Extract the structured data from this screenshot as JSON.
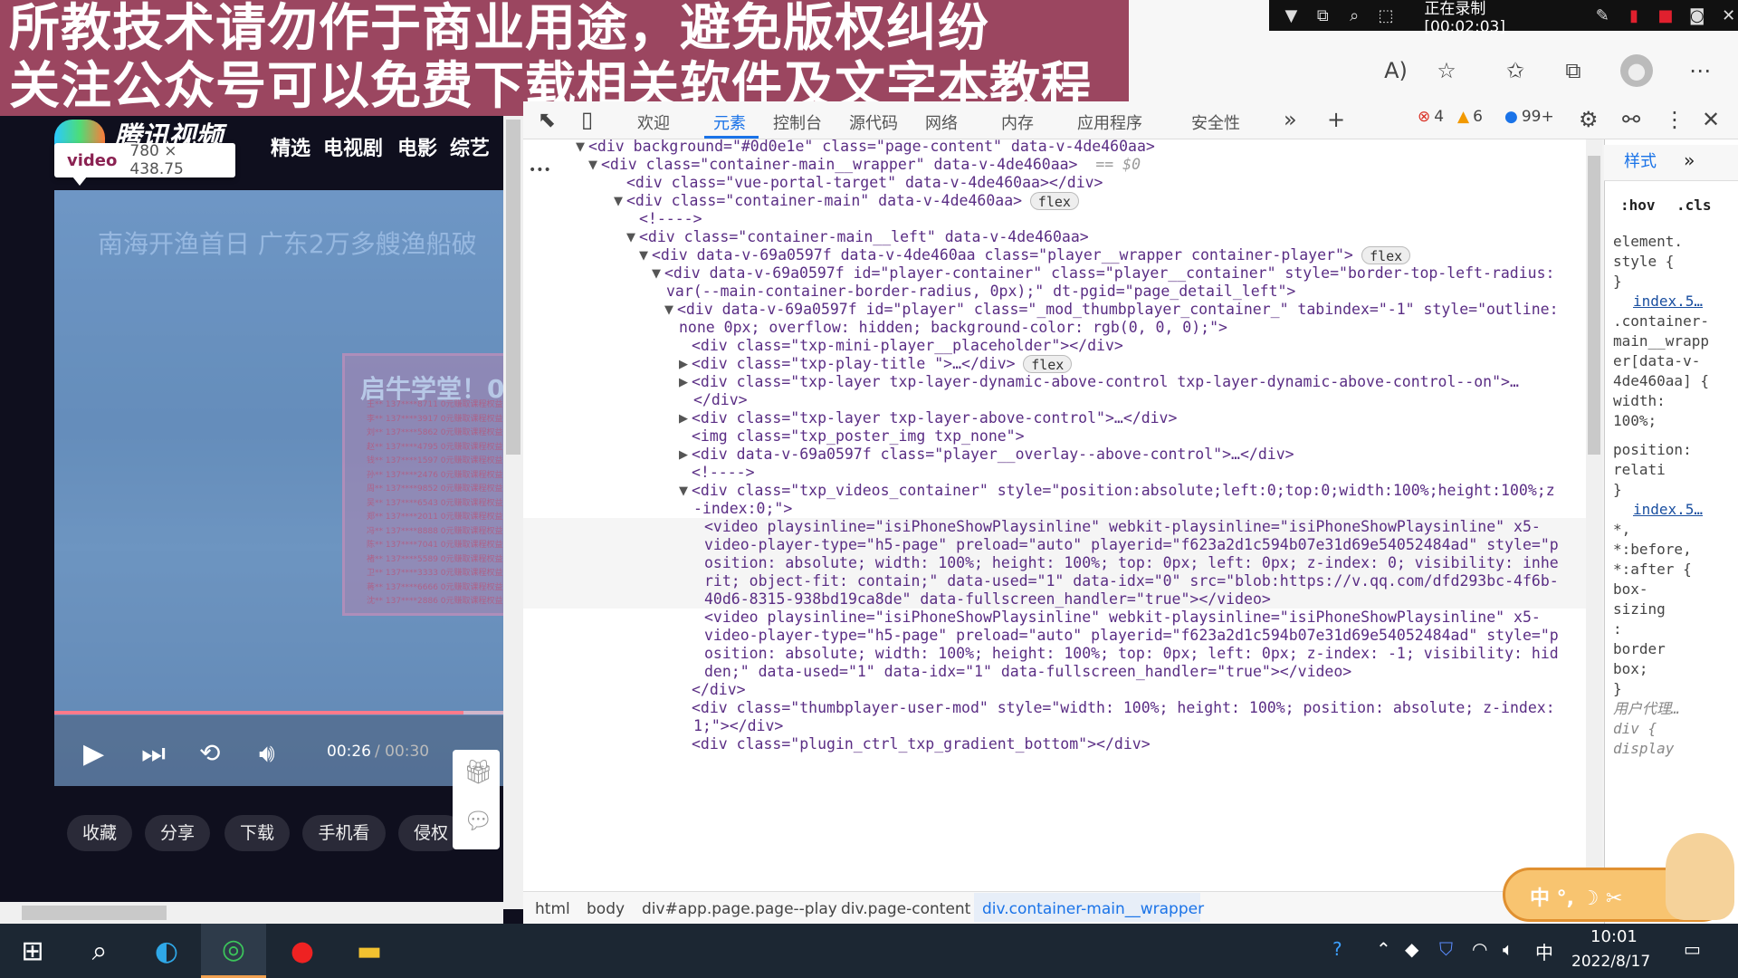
{
  "banner": {
    "line1": "所教技术请勿作于商业用途，避免版权纠纷",
    "line2": "关注公众号可以免费下载相关软件及文字本教程"
  },
  "recorder": {
    "status": "正在录制 [00:02:03]"
  },
  "site": {
    "logo": "腾讯视频",
    "nav": [
      "精选",
      "电视剧",
      "电影",
      "综艺"
    ]
  },
  "tooltip": {
    "tag": "video",
    "dimensions": "780 × 438.75"
  },
  "player": {
    "title": "南海开渔首日 广东2万多艘渔船破",
    "ad_title": "启牛学堂！0",
    "ad_rows": [
      "王**  137****8711  0元赚取课程权益",
      "李**  137****3917  0元赚取课程权益",
      "刘**  137****5862  0元赚取课程权益",
      "赵**  137****4795  0元赚取课程权益",
      "钱**  137****1597  0元赚取课程权益",
      "孙**  137****2476  0元赚取课程权益",
      "周**  137****9852  0元赚取课程权益",
      "吴**  137****6543  0元赚取课程权益",
      "郑**  137****2011  0元赚取课程权益",
      "冯**  137****8888  0元赚取课程权益",
      "陈**  137****7041  0元赚取课程权益",
      "褚**  137****5589  0元赚取课程权益",
      "卫**  137****3333  0元赚取课程权益",
      "蒋**  137****6666  0元赚取课程权益",
      "沈**  137****2886  0元赚取课程权益"
    ],
    "time_current": "00:26",
    "time_total": "/ 00:30",
    "progress": 0.87,
    "actions": [
      "收藏",
      "分享",
      "下载",
      "手机看",
      "侵权"
    ]
  },
  "devtools": {
    "tabs": [
      "欢迎",
      "元素",
      "控制台",
      "源代码",
      "网络",
      "内存",
      "应用程序",
      "安全性"
    ],
    "active_tab": "元素",
    "errors": "4",
    "warnings": "6",
    "issues": "99+",
    "dom": [
      {
        "text": "<div background=\"#0d0e1e\" class=\"page-content\" data-v-4de460aa>",
        "arrow": "▼"
      },
      {
        "text": "<div class=\"container-main__wrapper\" data-v-4de460aa>",
        "arrow": "▼",
        "suffix": "== $0"
      },
      {
        "text": "<div class=\"vue-portal-target\" data-v-4de460aa></div>"
      },
      {
        "text": "<div class=\"container-main\" data-v-4de460aa>",
        "arrow": "▼",
        "chip": "flex"
      },
      {
        "text": "<!---->"
      },
      {
        "text": "<div class=\"container-main__left\" data-v-4de460aa>",
        "arrow": "▼"
      },
      {
        "text": "<div data-v-69a0597f data-v-4de460aa class=\"player__wrapper container-player\">",
        "arrow": "▼",
        "chip": "flex"
      },
      {
        "text": "<div data-v-69a0597f id=\"player-container\" class=\"player__container\" style=\"border-top-left-radius:",
        "arrow": "▼"
      },
      {
        "text": "var(--main-container-border-radius, 0px);\" dt-pgid=\"page_detail_left\">"
      },
      {
        "text": "<div data-v-69a0597f id=\"player\" class=\"_mod_thumbplayer_container_\" tabindex=\"-1\" style=\"outline:",
        "arrow": "▼"
      },
      {
        "text": "none 0px; overflow: hidden; background-color: rgb(0, 0, 0);\">"
      },
      {
        "text": "<div class=\"txp-mini-player__placeholder\"></div>"
      },
      {
        "text": "<div class=\"txp-play-title \">…</div>",
        "arrow": "▶",
        "chip": "flex"
      },
      {
        "text": "<div class=\"txp-layer txp-layer-dynamic-above-control txp-layer-dynamic-above-control--on\">…",
        "arrow": "▶"
      },
      {
        "text": "</div>"
      },
      {
        "text": "<div class=\"txp-layer txp-layer-above-control\">…</div>",
        "arrow": "▶"
      },
      {
        "text": "<img class=\"txp_poster_img txp_none\">"
      },
      {
        "text": "<div data-v-69a0597f class=\"player__overlay--above-control\">…</div>",
        "arrow": "▶"
      },
      {
        "text": "<!---->"
      },
      {
        "text": "<div class=\"txp_videos_container\" style=\"position:absolute;left:0;top:0;width:100%;height:100%;z",
        "arrow": "▼"
      },
      {
        "text": "-index:0;\">"
      },
      {
        "text": "<video playsinline=\"isiPhoneShowPlaysinline\" webkit-playsinline=\"isiPhoneShowPlaysinline\" x5-"
      },
      {
        "text": "video-player-type=\"h5-page\" preload=\"auto\" playerid=\"f623a2d1c594b07e31d69e54052484ad\" style=\"p"
      },
      {
        "text": "osition: absolute; width: 100%; height: 100%; top: 0px; left: 0px; z-index: 0; visibility: inhe"
      },
      {
        "text": "rit; object-fit: contain;\" data-used=\"1\" data-idx=\"0\" src=\"blob:https://v.qq.com/dfd293bc-4f6b-"
      },
      {
        "text": "40d6-8315-938bd19ca8de\" data-fullscreen_handler=\"true\"></video>"
      },
      {
        "text": "<video playsinline=\"isiPhoneShowPlaysinline\" webkit-playsinline=\"isiPhoneShowPlaysinline\" x5-"
      },
      {
        "text": "video-player-type=\"h5-page\" preload=\"auto\" playerid=\"f623a2d1c594b07e31d69e54052484ad\" style=\"p"
      },
      {
        "text": "osition: absolute; width: 100%; height: 100%; top: 0px; left: 0px; z-index: -1; visibility: hid"
      },
      {
        "text": "den;\" data-used=\"1\" data-idx=\"1\" data-fullscreen_handler=\"true\"></video>"
      },
      {
        "text": "</div>"
      },
      {
        "text": "<div class=\"thumbplayer-user-mod\" style=\"width: 100%; height: 100%; position: absolute; z-index:"
      },
      {
        "text": "1;\"></div>"
      },
      {
        "text": "<div class=\"plugin_ctrl_txp_gradient_bottom\"></div>"
      }
    ],
    "breadcrumbs": [
      "html",
      "body",
      "div#app.page.page--play",
      "div.page-content",
      "div.container-main__wrapper"
    ],
    "styles": {
      "tab": "样式",
      "filters": [
        ":hov",
        ".cls"
      ],
      "lines": [
        {
          "t": "element.",
          "c": "prop"
        },
        {
          "t": "style {",
          "c": "prop"
        },
        {
          "t": "}",
          "c": "prop"
        },
        {
          "t": "index.5…",
          "c": "link"
        },
        {
          "t": ".container-",
          "c": "prop"
        },
        {
          "t": "main__wrapp",
          "c": "prop"
        },
        {
          "t": "er[data-v-",
          "c": "prop"
        },
        {
          "t": "4de460aa] {",
          "c": "prop"
        },
        {
          "t": "  width:",
          "c": "prop"
        },
        {
          "t": "     100%;",
          "c": "prop"
        },
        {
          "t": "",
          "c": "prop"
        },
        {
          "t": "position:",
          "c": "prop"
        },
        {
          "t": "     relati",
          "c": "prop"
        },
        {
          "t": "}",
          "c": "prop"
        },
        {
          "t": "index.5…",
          "c": "link"
        },
        {
          "t": "*,",
          "c": "prop"
        },
        {
          "t": "*:before,",
          "c": "prop"
        },
        {
          "t": "*:after {",
          "c": "prop"
        },
        {
          "t": "  box-",
          "c": "prop"
        },
        {
          "t": "     sizing",
          "c": "prop"
        },
        {
          "t": "     :",
          "c": "prop"
        },
        {
          "t": "     border",
          "c": "prop"
        },
        {
          "t": "     box;",
          "c": "prop"
        },
        {
          "t": "}",
          "c": "prop"
        },
        {
          "t": "   用户代理…",
          "c": "muted"
        },
        {
          "t": "div {",
          "c": "muted"
        },
        {
          "t": "  display",
          "c": "muted"
        }
      ]
    }
  },
  "ime": {
    "label": "中 °, ☽ ✂"
  },
  "taskbar": {
    "time": "10:01",
    "date": "2022/8/17",
    "ime_char": "中"
  }
}
